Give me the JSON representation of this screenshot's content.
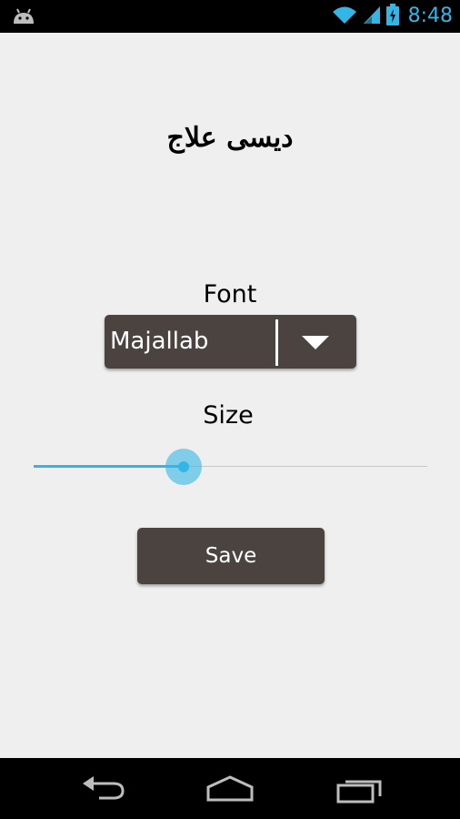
{
  "status_bar": {
    "time": "8:48",
    "left_icon": "android-icon",
    "icons": [
      "wifi-icon",
      "signal-icon",
      "battery-charging-icon"
    ],
    "accent_color": "#33b5e5"
  },
  "app": {
    "title": "دیسی علاج"
  },
  "font_section": {
    "label": "Font",
    "selected": "Majallab"
  },
  "size_section": {
    "label": "Size",
    "slider_value_fraction": 0.38
  },
  "actions": {
    "save_label": "Save"
  },
  "nav_bar": {
    "buttons": [
      "back-icon",
      "home-icon",
      "recent-apps-icon"
    ]
  },
  "colors": {
    "background": "#efefef",
    "control_bg": "#4a4340",
    "accent": "#33b5e5"
  }
}
